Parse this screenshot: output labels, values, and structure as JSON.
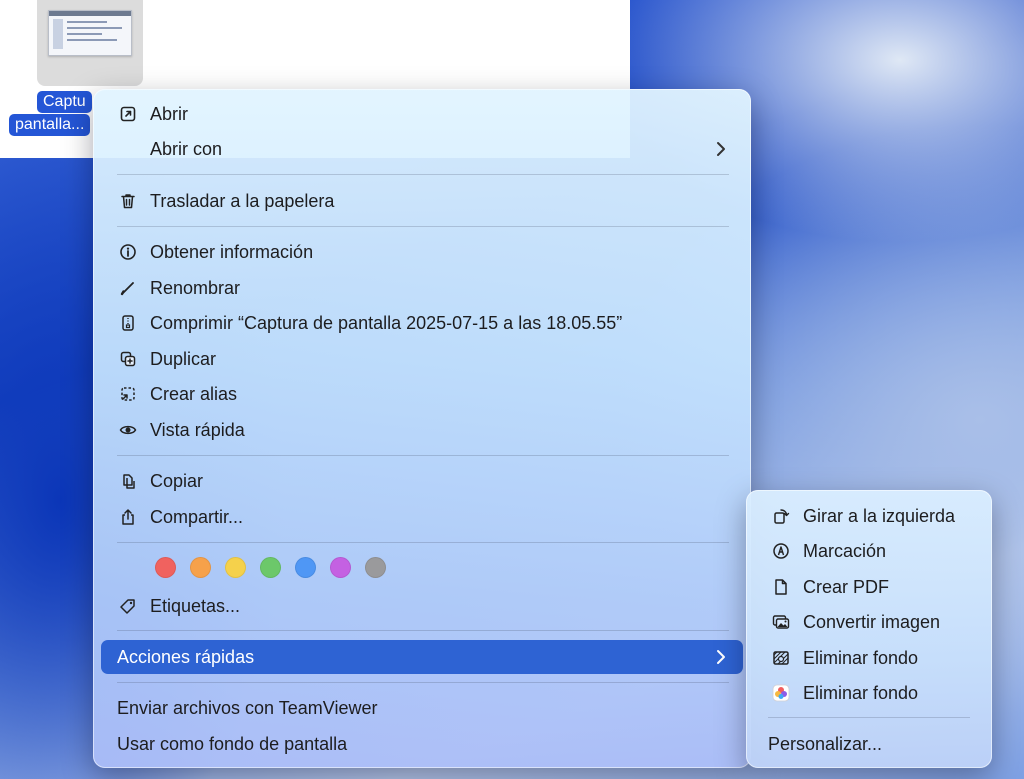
{
  "file": {
    "label_line1": "Captu",
    "label_line2": "pantalla..."
  },
  "menu": {
    "items": [
      {
        "label": "Abrir",
        "icon": "open-arrow-icon"
      },
      {
        "label": "Abrir con",
        "icon": ""
      },
      {
        "label": "Trasladar a la papelera",
        "icon": "trash-icon"
      },
      {
        "label": "Obtener información",
        "icon": "info-icon"
      },
      {
        "label": "Renombrar",
        "icon": "pencil-icon"
      },
      {
        "label": "Comprimir “Captura de pantalla 2025-07-15 a las 18.05.55”",
        "icon": "archive-icon"
      },
      {
        "label": "Duplicar",
        "icon": "duplicate-icon"
      },
      {
        "label": "Crear alias",
        "icon": "alias-icon"
      },
      {
        "label": "Vista rápida",
        "icon": "eye-icon"
      },
      {
        "label": "Copiar",
        "icon": "copy-icon"
      },
      {
        "label": "Compartir...",
        "icon": "share-icon"
      },
      {
        "label": "Etiquetas...",
        "icon": "tag-icon"
      },
      {
        "label": "Acciones rápidas",
        "icon": ""
      },
      {
        "label": "Enviar archivos con TeamViewer",
        "icon": ""
      },
      {
        "label": "Usar como fondo de pantalla",
        "icon": ""
      }
    ],
    "tag_colors": [
      "#f0625f",
      "#f6a14a",
      "#f5d14b",
      "#6cc86a",
      "#4f97f5",
      "#c461e2",
      "#9a9a9c"
    ],
    "selected_color": "#2e63d3"
  },
  "submenu": {
    "items": [
      {
        "label": "Girar a la izquierda",
        "icon": "rotate-left-icon"
      },
      {
        "label": "Marcación",
        "icon": "markup-icon"
      },
      {
        "label": "Crear PDF",
        "icon": "document-icon"
      },
      {
        "label": "Convertir imagen",
        "icon": "convert-image-icon"
      },
      {
        "label": "Eliminar fondo",
        "icon": "remove-background-icon"
      },
      {
        "label": "Eliminar fondo",
        "icon": "pixelmator-app-icon"
      },
      {
        "label": "Personalizar...",
        "icon": ""
      }
    ]
  }
}
